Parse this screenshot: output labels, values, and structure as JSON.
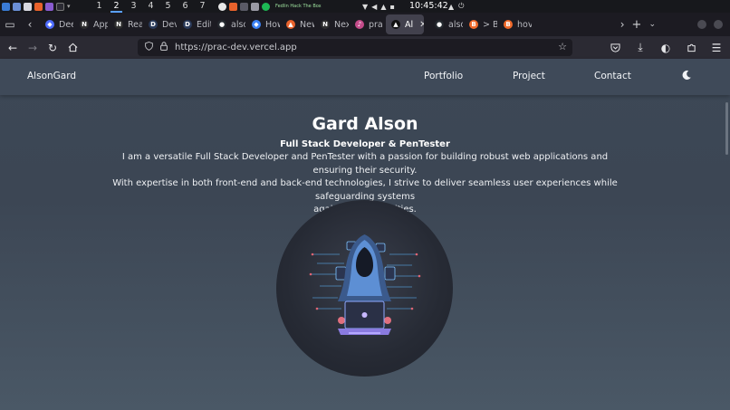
{
  "os": {
    "workspaces": [
      "1",
      "2",
      "3",
      "4",
      "5",
      "6",
      "7"
    ],
    "active_workspace": "2",
    "clock": "10:45:42",
    "media_text": "Fedlin Hack The Box"
  },
  "browser": {
    "tabs": [
      {
        "label": "Deep",
        "icon": "deepseek-icon",
        "color": "#4d6bfe"
      },
      {
        "label": "App",
        "icon": "notion-icon",
        "color": "#2f2f2f"
      },
      {
        "label": "Reac",
        "icon": "notion-icon",
        "color": "#2f2f2f"
      },
      {
        "label": "Devp",
        "icon": "dev-icon",
        "color": "#2a3a5a"
      },
      {
        "label": "Edit",
        "icon": "dev-icon",
        "color": "#2a3a5a"
      },
      {
        "label": "alson",
        "icon": "github-icon",
        "color": "#24292f"
      },
      {
        "label": "How",
        "icon": "diamond-icon",
        "color": "#3b82f6"
      },
      {
        "label": "New",
        "icon": "chart-icon",
        "color": "#e8622c"
      },
      {
        "label": "Next",
        "icon": "notion-icon",
        "color": "#2f2f2f"
      },
      {
        "label": "prac",
        "icon": "music-icon",
        "color": "#c44b8a"
      },
      {
        "label": "Al",
        "icon": "vercel-icon",
        "color": "#111111"
      },
      {
        "label": "alson",
        "icon": "github-icon",
        "color": "#24292f"
      },
      {
        "label": "> Bu",
        "icon": "brave-icon",
        "color": "#f06a2b"
      },
      {
        "label": "hov",
        "icon": "brave-icon",
        "color": "#f06a2b"
      }
    ],
    "active_tab_index": 10,
    "url": "https://prac-dev.vercel.app"
  },
  "site": {
    "brand": "AlsonGard",
    "nav": [
      "Portfolio",
      "Project",
      "Contact"
    ],
    "hero": {
      "name": "Gard Alson",
      "role": "Full Stack Developer & PenTester",
      "bio_lines": [
        "I am a versatile Full Stack Developer and PenTester with a passion for building robust web applications and ensuring their security.",
        "With expertise in both front-end and back-end technologies, I strive to deliver seamless user experiences while safeguarding systems",
        "against vulnerabilities."
      ]
    }
  },
  "colors": {
    "site_bg": "#3d4856",
    "header_bg": "#3f4a59",
    "accent_blue": "#5aa0ff",
    "browser_chrome": "#1c1b22"
  }
}
